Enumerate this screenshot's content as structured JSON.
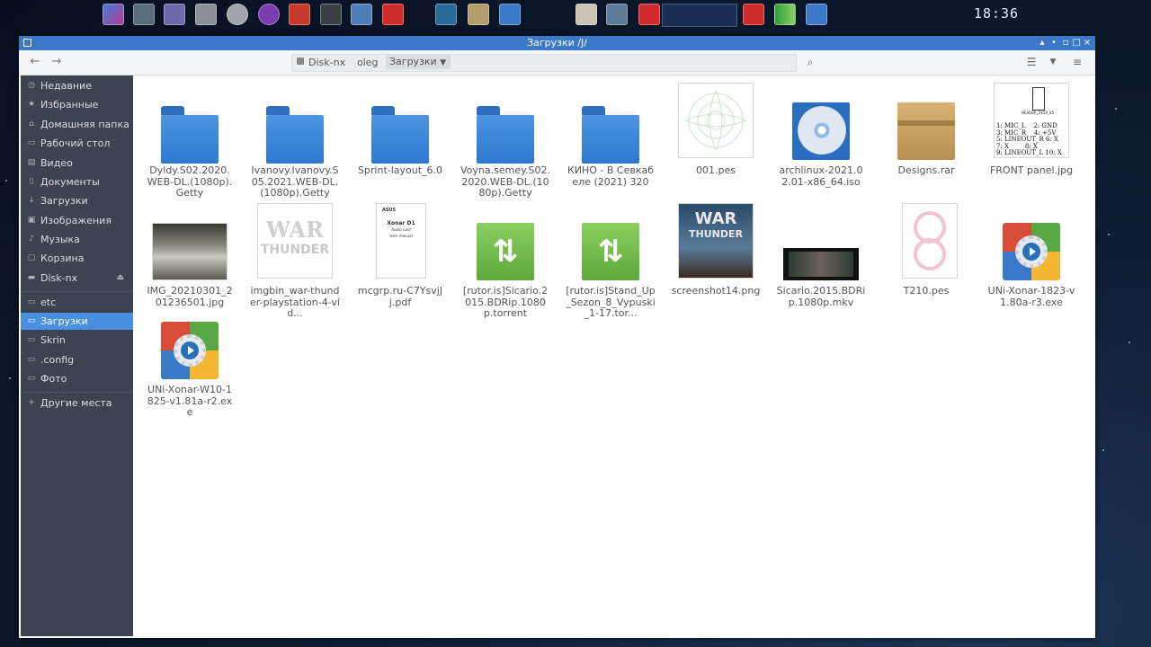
{
  "panel": {
    "clock": "18:36"
  },
  "window": {
    "title": "Загрузки   /J/"
  },
  "pathbar": {
    "crumbs": [
      "Disk-nx",
      "oleg",
      "Загрузки"
    ]
  },
  "sidebar": {
    "places": [
      {
        "label": "Недавние",
        "icon": "clock-icon"
      },
      {
        "label": "Избранные",
        "icon": "star-icon"
      },
      {
        "label": "Домашняя папка",
        "icon": "home-icon"
      },
      {
        "label": "Рабочий стол",
        "icon": "desktop-icon"
      },
      {
        "label": "Видео",
        "icon": "video-icon"
      },
      {
        "label": "Документы",
        "icon": "document-icon"
      },
      {
        "label": "Загрузки",
        "icon": "download-icon"
      },
      {
        "label": "Изображения",
        "icon": "image-icon"
      },
      {
        "label": "Музыка",
        "icon": "music-icon"
      },
      {
        "label": "Корзина",
        "icon": "trash-icon"
      },
      {
        "label": "Disk-nx",
        "icon": "drive-icon"
      }
    ],
    "bookmarks": [
      {
        "label": "etc"
      },
      {
        "label": "Загрузки",
        "active": true
      },
      {
        "label": "Skrin"
      },
      {
        "label": ".config"
      },
      {
        "label": "Фото"
      }
    ],
    "other": "Другие места"
  },
  "files": [
    {
      "name": "Dyldy.S02.2020.WEB-DL.(1080p).Getty",
      "type": "folder"
    },
    {
      "name": "Ivanovy.Ivanovy.S05.2021.WEB-DL.(1080p).Getty",
      "type": "folder"
    },
    {
      "name": "Sprint-layout_6.0",
      "type": "folder"
    },
    {
      "name": "Voyna.semey.S02.2020.WEB-DL.(1080p).Getty",
      "type": "folder"
    },
    {
      "name": "КИНО - В Севкабеле (2021) 320",
      "type": "folder"
    },
    {
      "name": "001.pes",
      "type": "pattern"
    },
    {
      "name": "archlinux-2021.02.01-x86_64.iso",
      "type": "disc"
    },
    {
      "name": "Designs.rar",
      "type": "archive"
    },
    {
      "name": "FRONT panel.jpg",
      "type": "schematic"
    },
    {
      "name": "IMG_20210301_201236501.jpg",
      "type": "photo"
    },
    {
      "name": "imgbin_war-thunder-playstation-4-vid...",
      "type": "logo"
    },
    {
      "name": "mcgrp.ru-C7YsvjJj.pdf",
      "type": "pdf"
    },
    {
      "name": "[rutor.is]Sicario.2015.BDRip.1080p.torrent",
      "type": "torrent"
    },
    {
      "name": "[rutor.is]Stand_Up_Sezon_8_Vypuski_1-17.tor...",
      "type": "torrent"
    },
    {
      "name": "screenshot14.png",
      "type": "screenshot"
    },
    {
      "name": "Sicario.2015.BDRip.1080p.mkv",
      "type": "video"
    },
    {
      "name": "T210.pes",
      "type": "pattern2"
    },
    {
      "name": "UNi-Xonar-1823-v1.80a-r3.exe",
      "type": "exe"
    },
    {
      "name": "UNi-Xonar-W10-1825-v1.81a-r2.exe",
      "type": "exe"
    }
  ],
  "thumb_text": {
    "war": "WAR",
    "thunder": "THUNDER",
    "pdf_brand": "ASUS",
    "pdf_title": "Xonar D1",
    "pdf_sub": "Audio card",
    "pdf_manual": "User manual",
    "schematic_header": "HEADER_2X5P_X5",
    "schematic_pins": "1: MIC_L    2: GND\n3: MIC_R    4: +5V\n5: LINEOUT_R 6: X\n7: X        8: X\n9: LINEOUT_L 10: X"
  },
  "colors": {
    "accent": "#4a90e2",
    "titlebar": "#3b78c8",
    "sidebar": "#3b4450",
    "folder": "#3a86d8",
    "torrent": "#6cb84a"
  }
}
